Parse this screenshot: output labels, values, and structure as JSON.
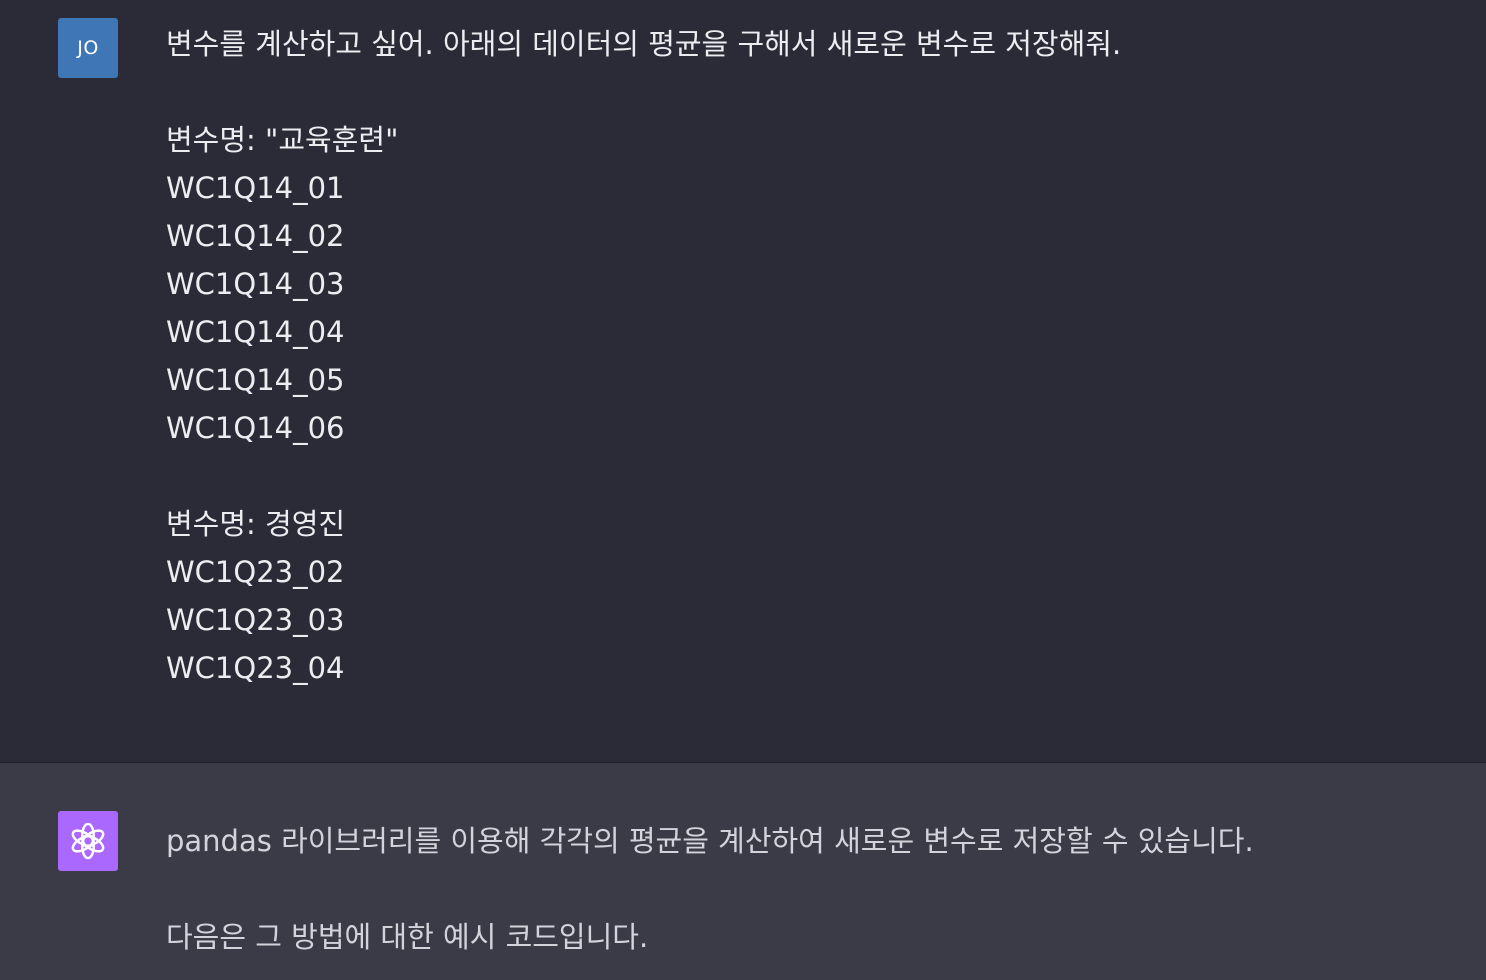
{
  "conversation": {
    "user": {
      "avatar_initials": "JO",
      "avatar_color": "#3f76b5",
      "message_lines": [
        "변수를 계산하고 싶어. 아래의 데이터의 평균을 구해서 새로운 변수로 저장해줘.",
        "",
        "변수명: \"교육훈련\"",
        "WC1Q14_01",
        "WC1Q14_02",
        "WC1Q14_03",
        "WC1Q14_04",
        "WC1Q14_05",
        "WC1Q14_06",
        "",
        "변수명: 경영진",
        "WC1Q23_02",
        "WC1Q23_03",
        "WC1Q23_04"
      ]
    },
    "assistant": {
      "avatar_icon": "openai-logo-icon",
      "avatar_color": "#ab68ff",
      "message_lines": [
        "pandas 라이브러리를 이용해 각각의 평균을 계산하여 새로운 변수로 저장할 수 있습니다.",
        "",
        "다음은 그 방법에 대한 예시 코드입니다."
      ]
    }
  }
}
